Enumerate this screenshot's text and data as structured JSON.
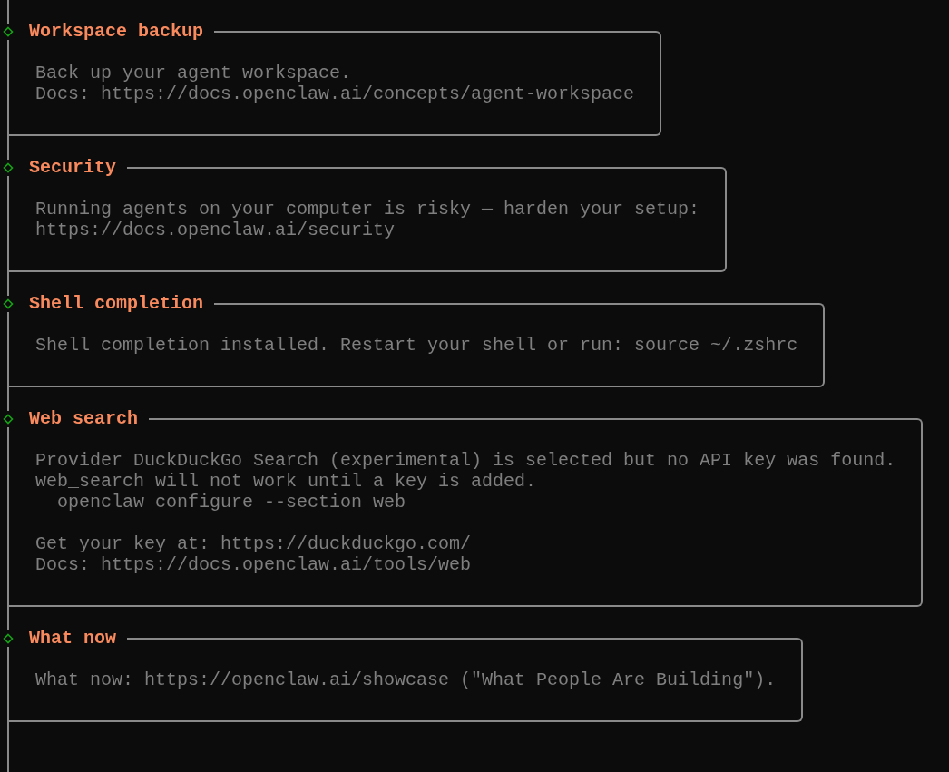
{
  "sections": [
    {
      "title": "Workspace backup",
      "paragraphs": [
        [
          {
            "kind": "text",
            "text": "Back up your agent workspace."
          },
          {
            "kind": "text",
            "text": "Docs: https://docs.openclaw.ai/concepts/agent-workspace"
          }
        ]
      ]
    },
    {
      "title": "Security",
      "paragraphs": [
        [
          {
            "kind": "text",
            "text": "Running agents on your computer is risky — harden your setup:"
          },
          {
            "kind": "text",
            "text": "https://docs.openclaw.ai/security"
          }
        ]
      ]
    },
    {
      "title": "Shell completion",
      "paragraphs": [
        [
          {
            "kind": "text",
            "text": "Shell completion installed. Restart your shell or run: source ~/.zshrc"
          }
        ]
      ]
    },
    {
      "title": "Web search",
      "paragraphs": [
        [
          {
            "kind": "text",
            "text": "Provider DuckDuckGo Search (experimental) is selected but no API key was found."
          },
          {
            "kind": "text",
            "text": "web_search will not work until a key is added."
          },
          {
            "kind": "command",
            "text": "openclaw configure --section web"
          }
        ],
        [
          {
            "kind": "text",
            "text": "Get your key at: https://duckduckgo.com/"
          },
          {
            "kind": "text",
            "text": "Docs: https://docs.openclaw.ai/tools/web"
          }
        ]
      ]
    },
    {
      "title": "What now",
      "paragraphs": [
        [
          {
            "kind": "text",
            "text": "What now: https://openclaw.ai/showcase (\"What People Are Building\")."
          }
        ]
      ]
    }
  ]
}
